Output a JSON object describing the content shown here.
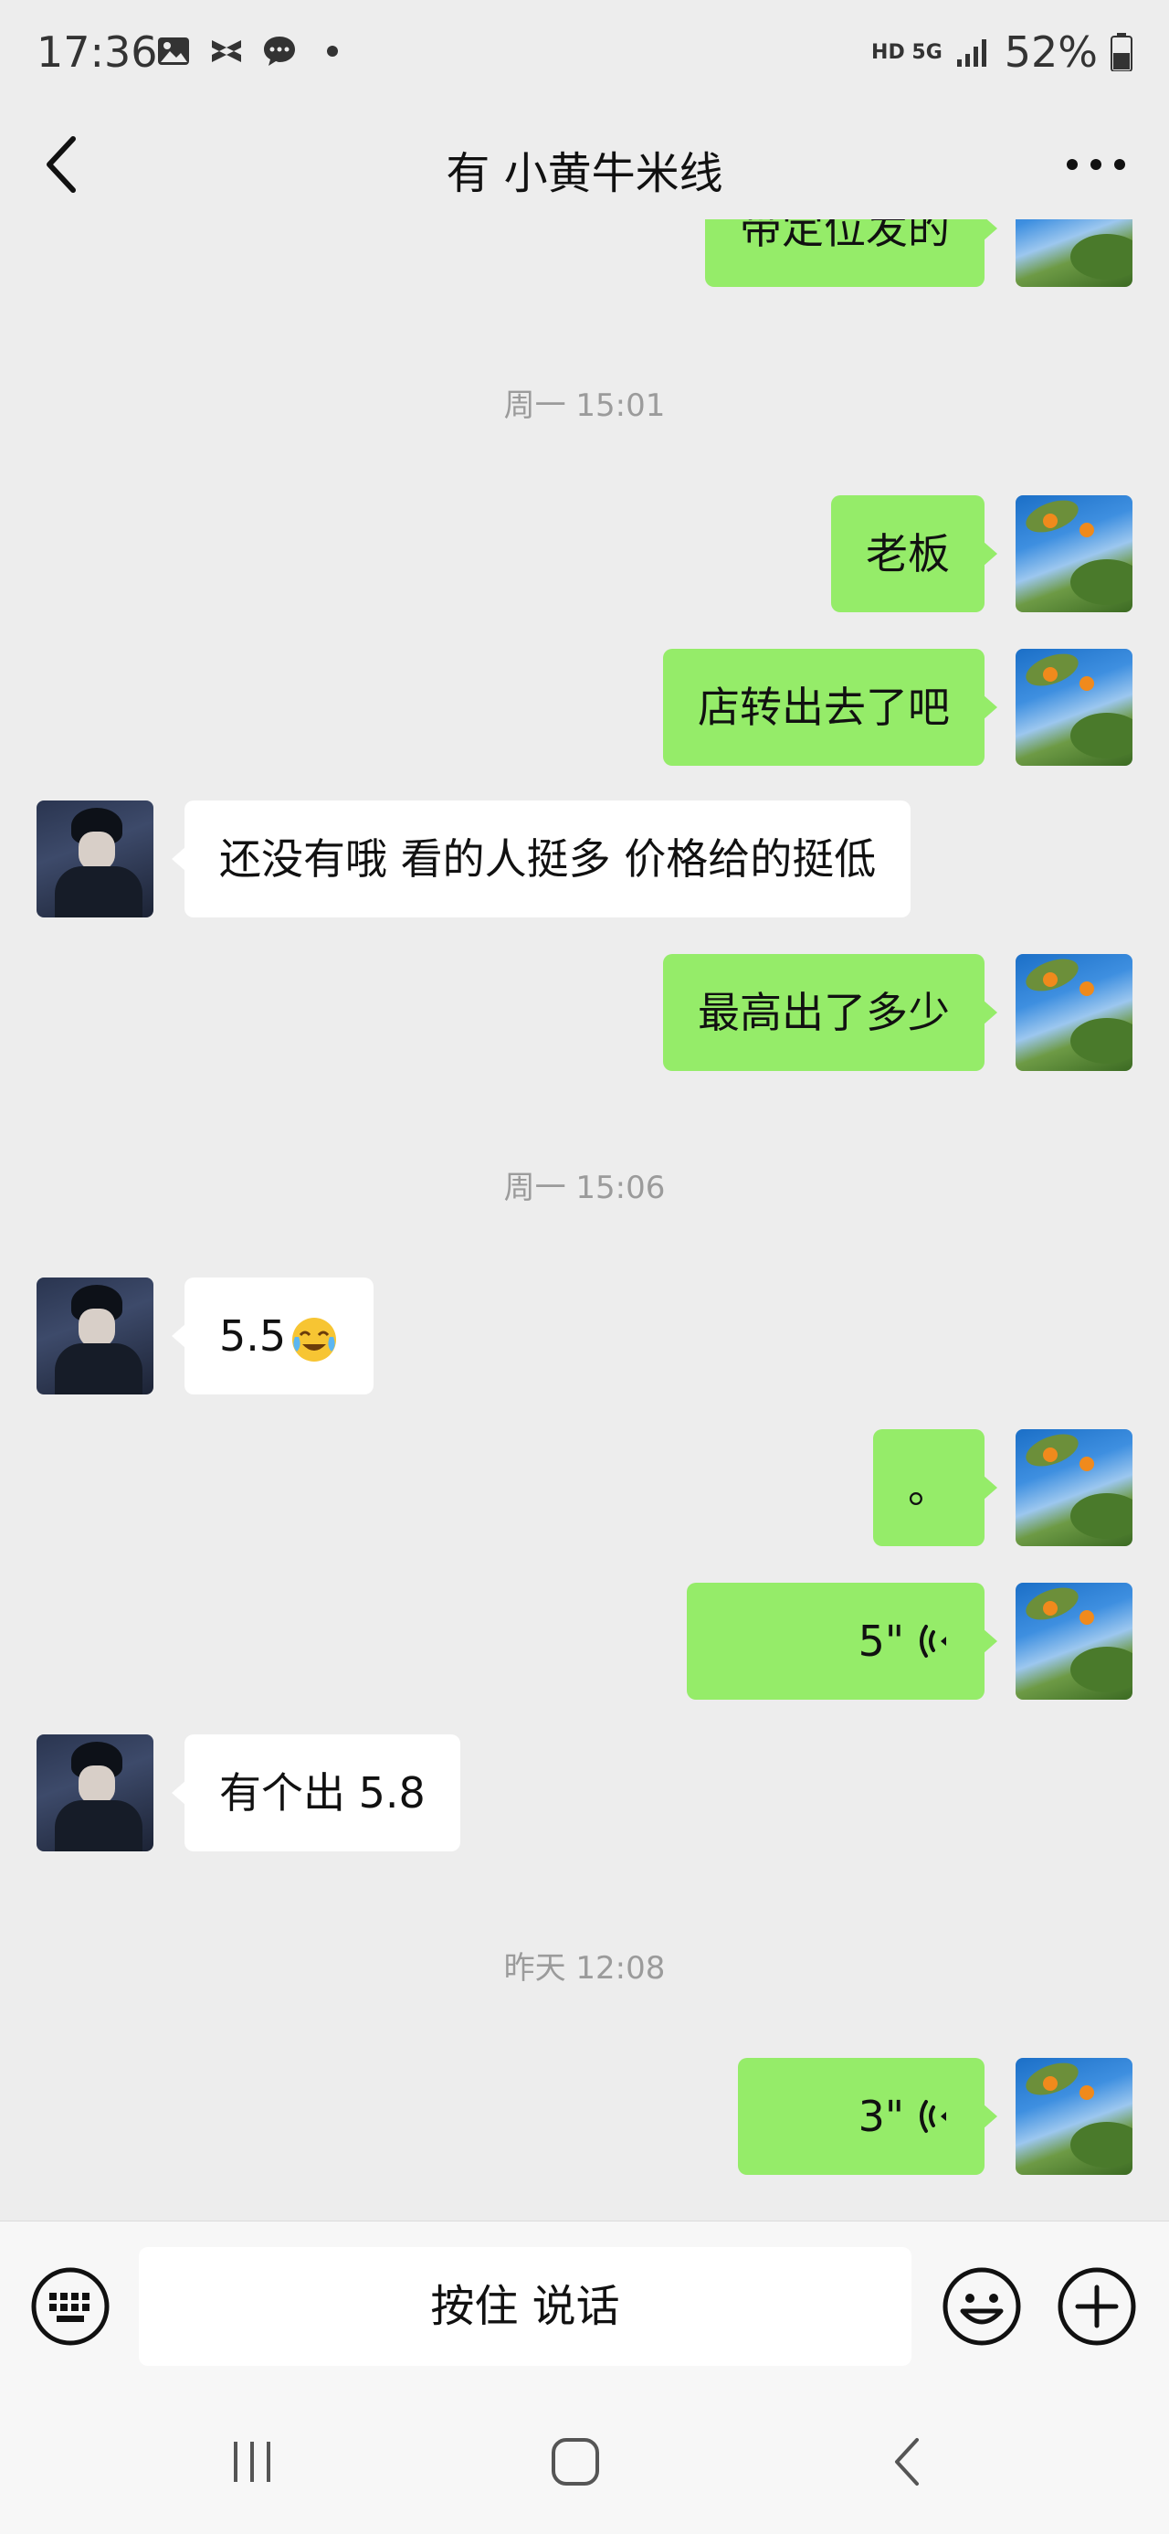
{
  "status_bar": {
    "time": "17:36",
    "network": "HD 5G",
    "battery": "52%"
  },
  "nav": {
    "title": "有 小黄牛米线"
  },
  "messages": {
    "m0": "带定位发的",
    "t1": "周一 15:01",
    "m1": "老板",
    "m2": "店转出去了吧",
    "m3": "还没有哦  看的人挺多 价格给的挺低",
    "m4": "最高出了多少",
    "t2": "周一 15:06",
    "m5": "5.5",
    "m6": "。",
    "m7": "5\"",
    "m8": "有个出 5.8",
    "t3": "昨天 12:08",
    "m9": "3\""
  },
  "input_bar": {
    "hold_to_talk": "按住 说话"
  },
  "colors": {
    "background": "#ededed",
    "bubble_me": "#95ec69",
    "bubble_other": "#ffffff",
    "timestamp": "#9b9b9b"
  }
}
